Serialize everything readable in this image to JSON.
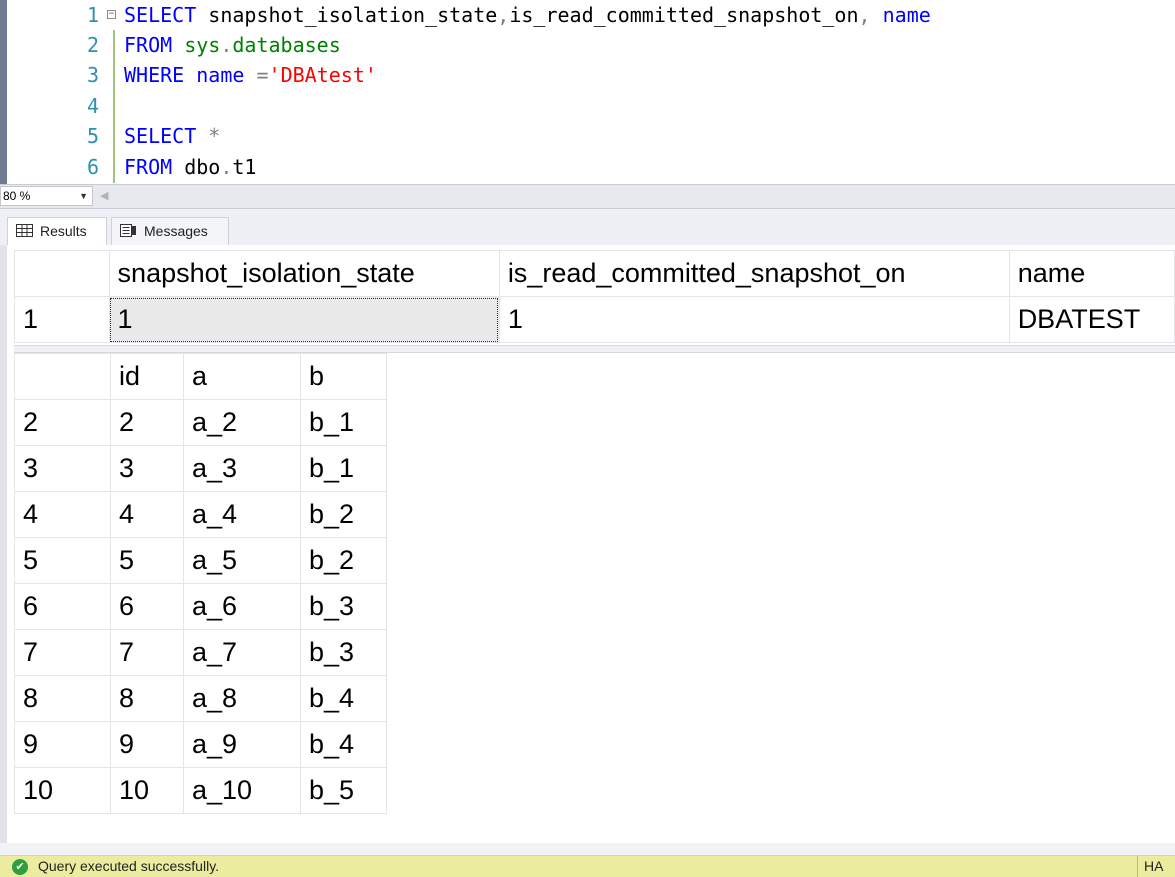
{
  "editor": {
    "lines": [
      {
        "num": "1",
        "parts": [
          {
            "t": "SELECT",
            "c": "kw"
          },
          {
            "t": " snapshot_isolation_state",
            "c": "id"
          },
          {
            "t": ",",
            "c": "op"
          },
          {
            "t": "is_read_committed_snapshot_on",
            "c": "id"
          },
          {
            "t": ",",
            "c": "op"
          },
          {
            "t": " ",
            "c": "id"
          },
          {
            "t": "name",
            "c": "kw"
          }
        ]
      },
      {
        "num": "2",
        "parts": [
          {
            "t": "FROM",
            "c": "kw"
          },
          {
            "t": " ",
            "c": "id"
          },
          {
            "t": "sys",
            "c": "sys"
          },
          {
            "t": ".",
            "c": "op"
          },
          {
            "t": "databases",
            "c": "sys"
          }
        ]
      },
      {
        "num": "3",
        "parts": [
          {
            "t": "WHERE",
            "c": "kw"
          },
          {
            "t": " ",
            "c": "id"
          },
          {
            "t": "name",
            "c": "kw"
          },
          {
            "t": " =",
            "c": "op"
          },
          {
            "t": "'DBAtest'",
            "c": "str"
          }
        ]
      },
      {
        "num": "4",
        "parts": []
      },
      {
        "num": "5",
        "parts": [
          {
            "t": "SELECT",
            "c": "kw"
          },
          {
            "t": " ",
            "c": "id"
          },
          {
            "t": "*",
            "c": "op"
          }
        ]
      },
      {
        "num": "6",
        "parts": [
          {
            "t": "FROM",
            "c": "kw"
          },
          {
            "t": " dbo",
            "c": "id"
          },
          {
            "t": ".",
            "c": "op"
          },
          {
            "t": "t1",
            "c": "id"
          }
        ]
      }
    ]
  },
  "zoom": {
    "value": "80 %"
  },
  "tabs": {
    "results": "Results",
    "messages": "Messages"
  },
  "grid1": {
    "columns": [
      "snapshot_isolation_state",
      "is_read_committed_snapshot_on",
      "name"
    ],
    "rows": [
      {
        "num": "1",
        "cells": [
          "1",
          "1",
          "DBATEST"
        ]
      }
    ]
  },
  "grid2": {
    "columns": [
      "id",
      "a",
      "b"
    ],
    "rows": [
      {
        "num": "2",
        "cells": [
          "2",
          "a_2",
          "b_1"
        ]
      },
      {
        "num": "3",
        "cells": [
          "3",
          "a_3",
          "b_1"
        ]
      },
      {
        "num": "4",
        "cells": [
          "4",
          "a_4",
          "b_2"
        ]
      },
      {
        "num": "5",
        "cells": [
          "5",
          "a_5",
          "b_2"
        ]
      },
      {
        "num": "6",
        "cells": [
          "6",
          "a_6",
          "b_3"
        ]
      },
      {
        "num": "7",
        "cells": [
          "7",
          "a_7",
          "b_3"
        ]
      },
      {
        "num": "8",
        "cells": [
          "8",
          "a_8",
          "b_4"
        ]
      },
      {
        "num": "9",
        "cells": [
          "9",
          "a_9",
          "b_4"
        ]
      },
      {
        "num": "10",
        "cells": [
          "10",
          "a_10",
          "b_5"
        ]
      }
    ]
  },
  "status": {
    "message": "Query executed successfully.",
    "right": "HA",
    "icon": "check-circle-icon"
  },
  "colors": {
    "keyword": "#0000ff",
    "system": "#008000",
    "string": "#ff0000",
    "status_bar": "#ecec9e"
  }
}
